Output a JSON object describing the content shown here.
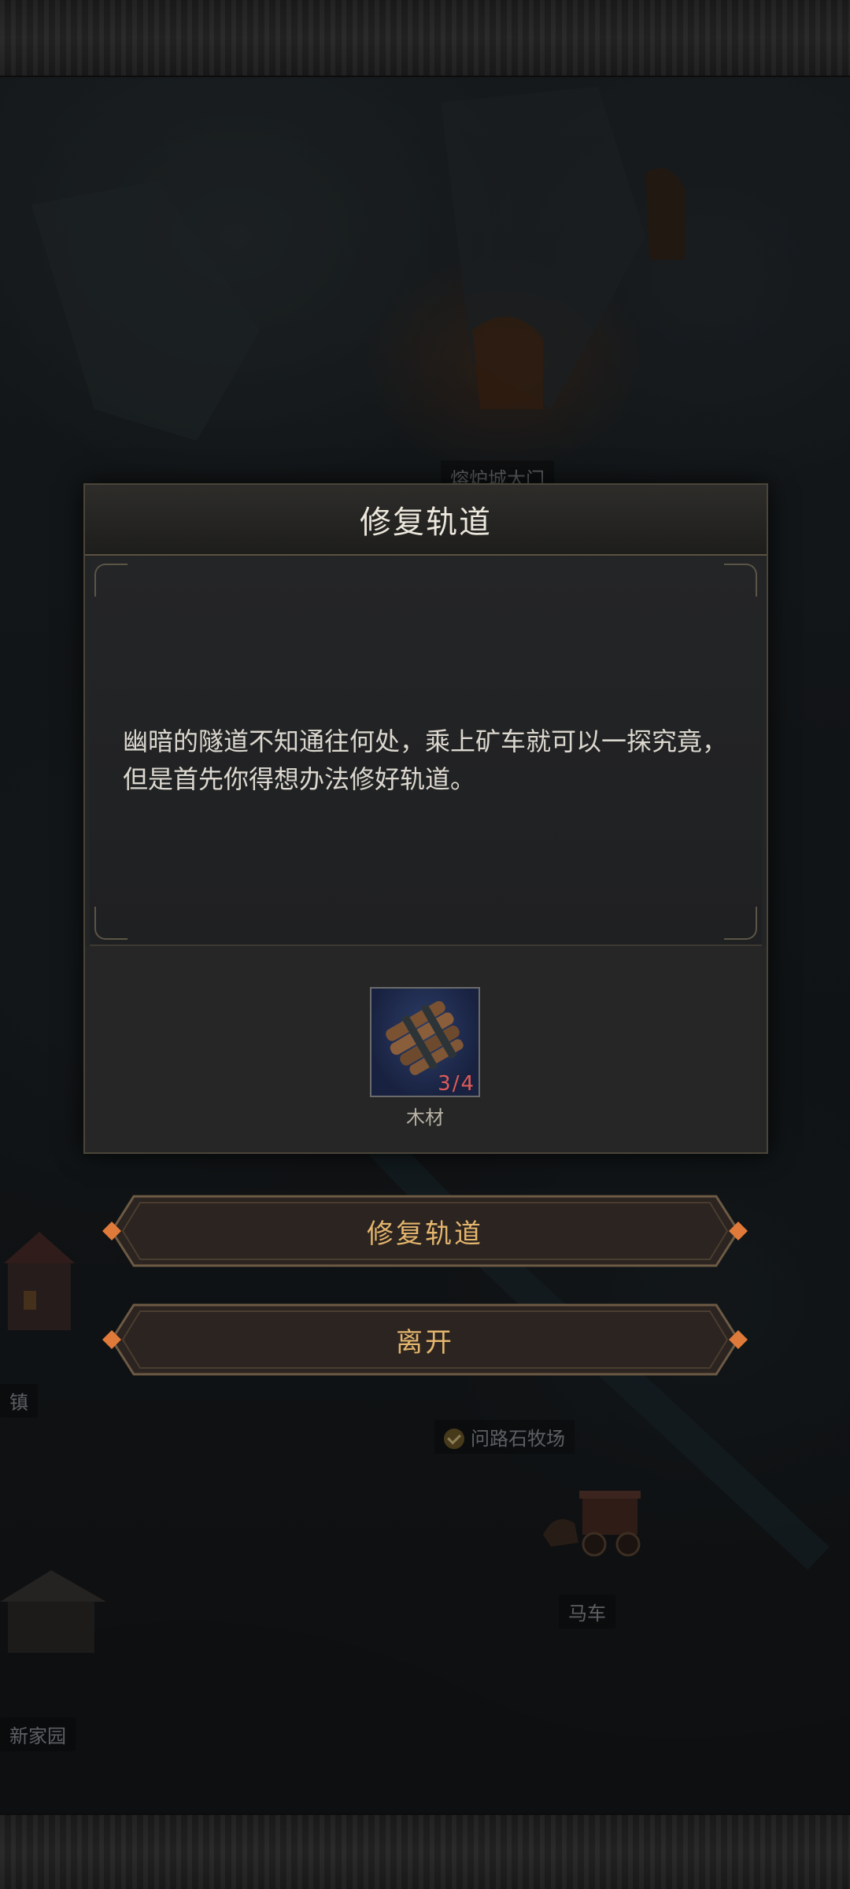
{
  "map": {
    "labels": {
      "gate": "熔炉城大门",
      "town": "镇",
      "pasture": "问路石牧场",
      "carriage": "马车",
      "home": "新家园"
    }
  },
  "dialog": {
    "title": "修复轨道",
    "description": "幽暗的隧道不知通往何处，乘上矿车就可以一探究竟，但是首先你得想办法修好轨道。",
    "item": {
      "icon": "wood-bundle-icon",
      "count": "3/4",
      "name": "木材"
    }
  },
  "actions": {
    "repair_label": "修复轨道",
    "leave_label": "离开"
  },
  "colors": {
    "accent_gold": "#e4b56d",
    "count_red": "#e05a58",
    "item_bg": "#2d3e6a"
  }
}
